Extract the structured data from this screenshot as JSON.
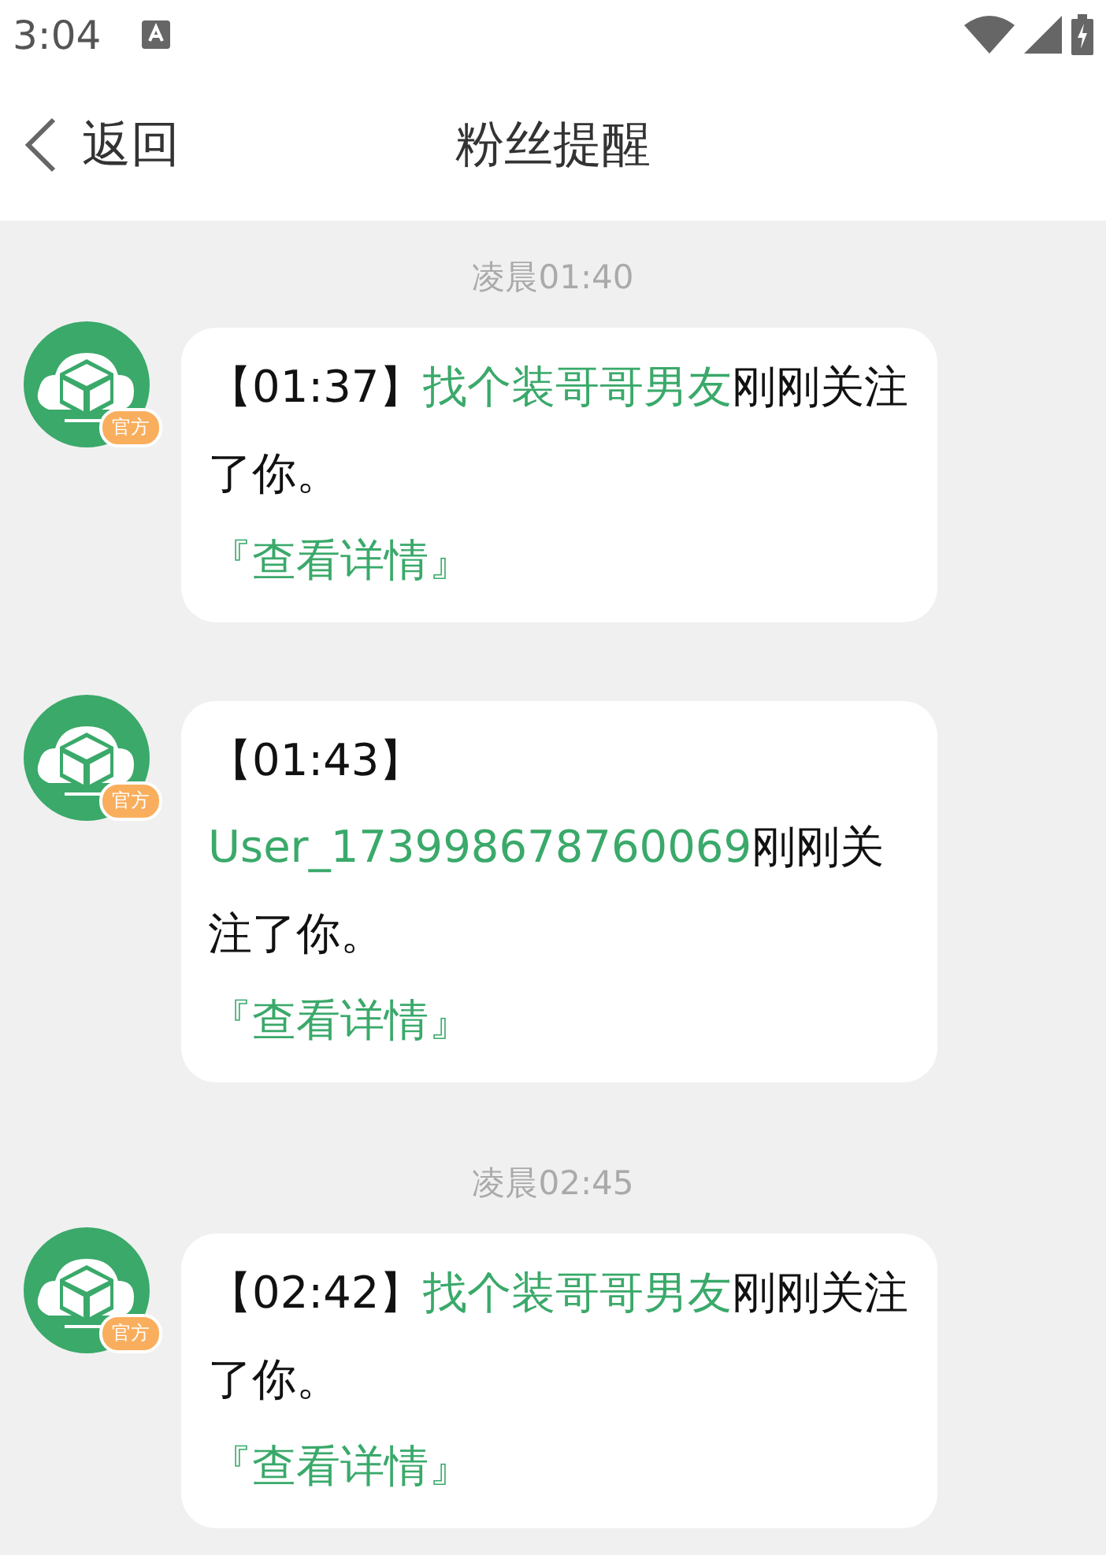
{
  "status_bar": {
    "time": "3:04"
  },
  "header": {
    "back": "返回",
    "title": "粉丝提醒"
  },
  "messages": [
    {
      "date": "凌晨01:40",
      "badge": "官方",
      "time": "【01:37】",
      "user": "找个装哥哥男友",
      "action": "刚刚关注了你。",
      "link": "『查看详情』"
    },
    {
      "badge": "官方",
      "time": "【01:43】",
      "user": "User_173998678760069",
      "action": "刚刚关注了你。",
      "link": "『查看详情』"
    },
    {
      "date": "凌晨02:45",
      "badge": "官方",
      "time": "【02:42】",
      "user": "找个装哥哥男友",
      "action": "刚刚关注了你。",
      "link": "『查看详情』"
    }
  ]
}
